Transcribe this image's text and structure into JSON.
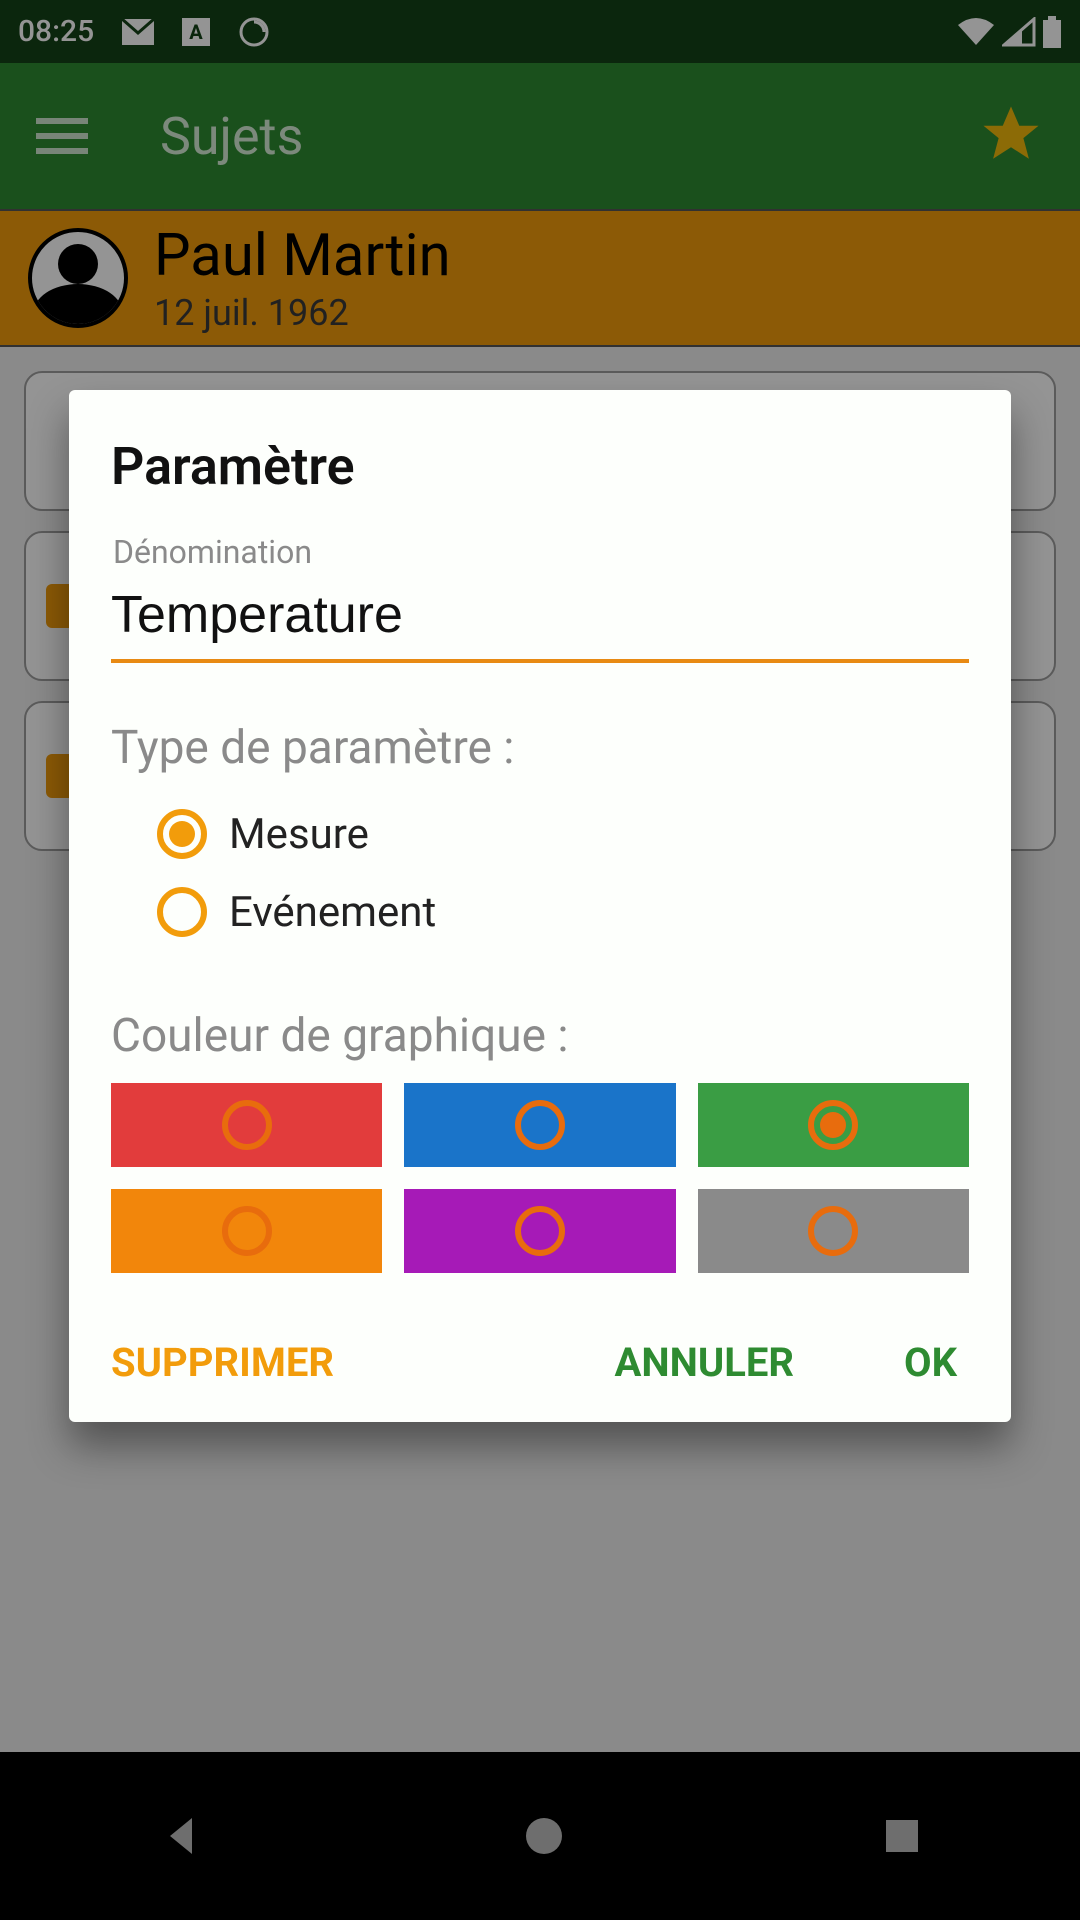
{
  "status": {
    "time": "08:25"
  },
  "appbar": {
    "title": "Sujets"
  },
  "person": {
    "name": "Paul Martin",
    "date": "12 juil. 1962"
  },
  "dialog": {
    "title": "Paramètre",
    "name_label": "Dénomination",
    "name_value": "Temperature",
    "type_label": "Type de paramètre :",
    "type_options": {
      "measure": "Mesure",
      "event": "Evénement"
    },
    "type_selected": "measure",
    "color_label": "Couleur de graphique :",
    "colors": {
      "red": "#e23c3c",
      "blue": "#1a74c9",
      "green": "#3a9d44",
      "orange": "#f2860b",
      "purple": "#a61ab7",
      "gray": "#8a8a8a"
    },
    "color_selected": "green",
    "actions": {
      "delete": "SUPPRIMER",
      "cancel": "ANNULER",
      "ok": "OK"
    }
  }
}
